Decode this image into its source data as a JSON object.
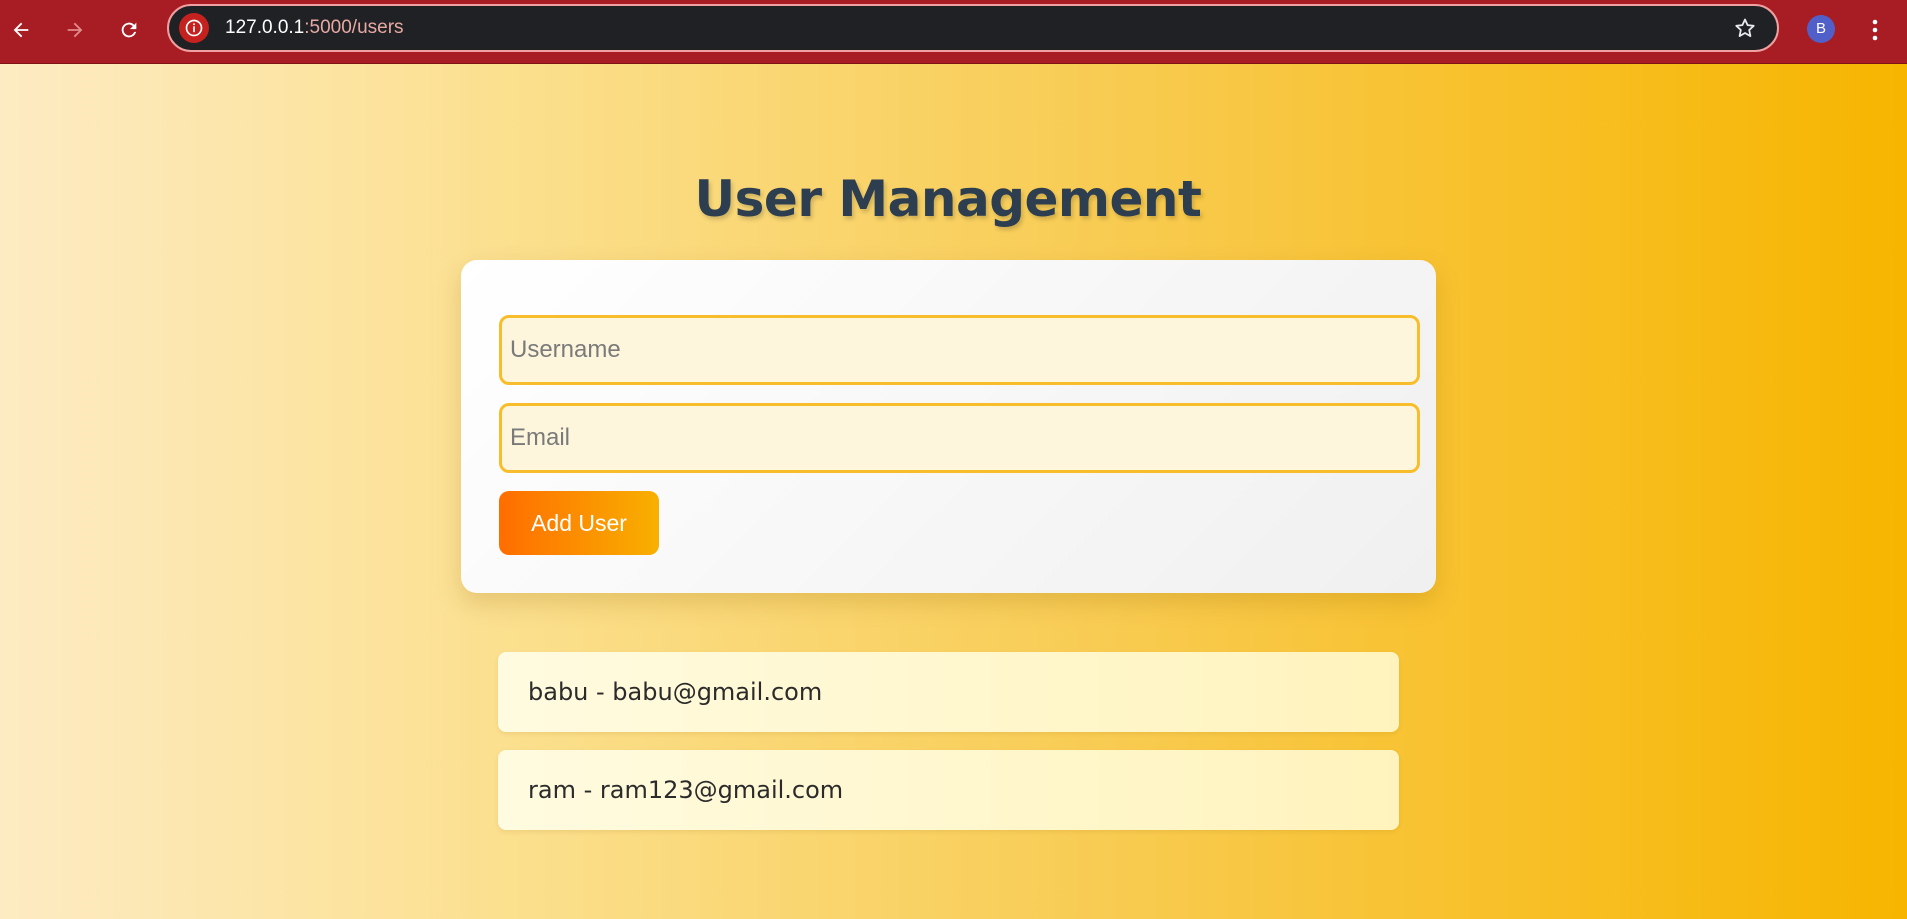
{
  "browser": {
    "url_host": "127.0.0.1",
    "url_path": ":5000/users",
    "profile_initial": "B",
    "icons": {
      "back": "arrow-left-icon",
      "forward": "arrow-right-icon",
      "reload": "reload-icon",
      "site_info": "info-icon",
      "bookmark": "star-icon",
      "menu": "more-vert-icon"
    }
  },
  "page": {
    "title": "User Management",
    "form": {
      "username_placeholder": "Username",
      "username_value": "",
      "email_placeholder": "Email",
      "email_value": "",
      "submit_label": "Add User"
    },
    "users": [
      {
        "text": "babu - babu@gmail.com"
      },
      {
        "text": "ram - ram123@gmail.com"
      }
    ]
  },
  "colors": {
    "chrome_bg": "#a81c23",
    "title": "#2c3e50",
    "accent_start": "#ff6d00",
    "accent_end": "#f8b000",
    "field_border": "#f8bd2b"
  }
}
